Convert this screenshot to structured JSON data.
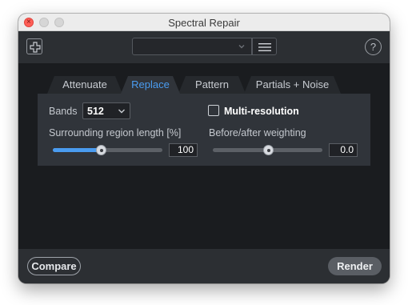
{
  "window": {
    "title": "Spectral Repair"
  },
  "toolbar": {
    "add_icon": "plus-square-icon",
    "preset_value": "",
    "menu_icon": "hamburger-menu-icon",
    "help_label": "?"
  },
  "tabs": [
    {
      "label": "Attenuate",
      "active": false
    },
    {
      "label": "Replace",
      "active": true
    },
    {
      "label": "Pattern",
      "active": false
    },
    {
      "label": "Partials + Noise",
      "active": false
    }
  ],
  "controls": {
    "bands_label": "Bands",
    "bands_value": "512",
    "multi_resolution_label": "Multi-resolution",
    "multi_resolution_checked": false,
    "surrounding_label": "Surrounding region length [%]",
    "surrounding_value": "100",
    "surrounding_fraction": 0.44,
    "weighting_label": "Before/after weighting",
    "weighting_value": "0.0",
    "weighting_fraction": 0.5
  },
  "footer": {
    "compare_label": "Compare",
    "render_label": "Render"
  },
  "colors": {
    "accent": "#4a9cf0",
    "window_bg": "#1a1c1f",
    "panel_bg": "#30343a"
  }
}
